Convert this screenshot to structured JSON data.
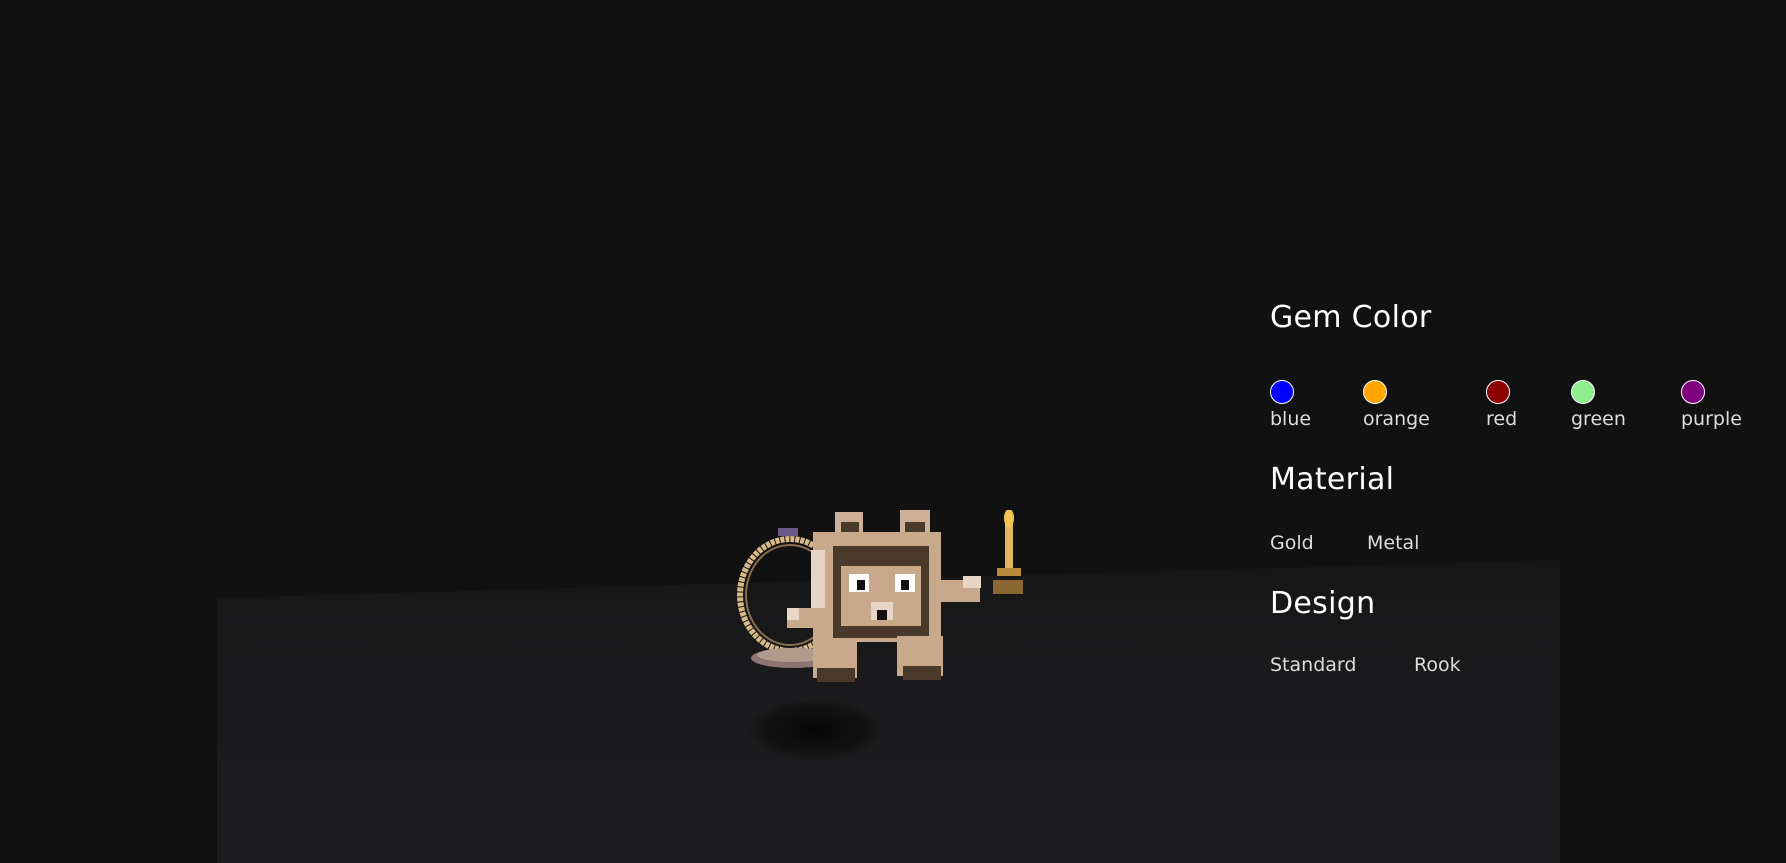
{
  "panel": {
    "gem_color": {
      "title": "Gem Color",
      "options": [
        {
          "label": "blue",
          "color": "#0000ff"
        },
        {
          "label": "orange",
          "color": "#ffa500"
        },
        {
          "label": "red",
          "color": "#8b0000"
        },
        {
          "label": "green",
          "color": "#90ee90"
        },
        {
          "label": "purple",
          "color": "#800080"
        }
      ]
    },
    "material": {
      "title": "Material",
      "options": [
        {
          "label": "Gold"
        },
        {
          "label": "Metal"
        }
      ]
    },
    "design": {
      "title": "Design",
      "options": [
        {
          "label": "Standard"
        },
        {
          "label": "Rook"
        }
      ]
    }
  },
  "scene": {
    "background": "#111112",
    "model_colors": {
      "body": "#c9a98c",
      "shade": "#4a3a2c",
      "ring": "#d7b98a",
      "candle": "#d9a441"
    }
  }
}
